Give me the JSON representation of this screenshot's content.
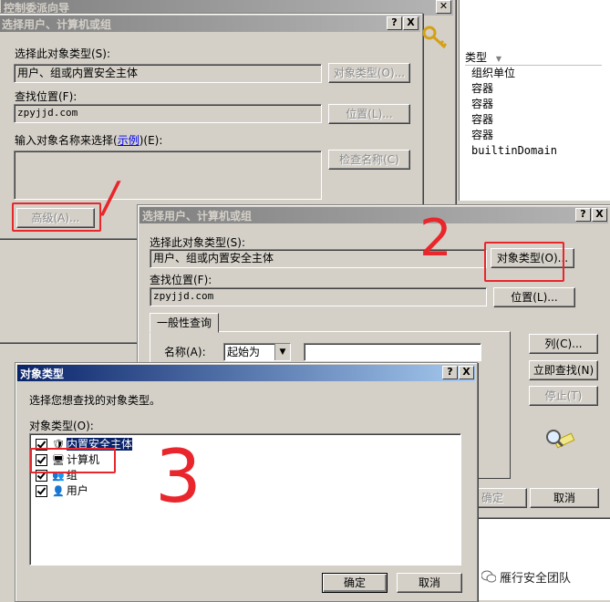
{
  "bg_wizard": {
    "title": "控制委派向导"
  },
  "right_panel": {
    "column_header": "类型",
    "items": [
      "组织单位",
      "容器",
      "容器",
      "容器",
      "容器",
      "builtinDomain"
    ]
  },
  "dialog1": {
    "title": "选择用户、计算机或组",
    "help": "?",
    "close": "X",
    "obj_type_label": "选择此对象类型(S):",
    "obj_type_value": "用户、组或内置安全主体",
    "obj_type_btn": "对象类型(O)...",
    "location_label": "查找位置(F):",
    "location_value": "zpyjjd.com",
    "location_btn": "位置(L)...",
    "enter_label_pre": "输入对象名称来选择(",
    "enter_label_link": "示例",
    "enter_label_post": ")(E):",
    "check_names_btn": "检查名称(C)",
    "advanced_btn": "高级(A)..."
  },
  "dialog2": {
    "title": "选择用户、计算机或组",
    "help": "?",
    "close": "X",
    "obj_type_label": "选择此对象类型(S):",
    "obj_type_value": "用户、组或内置安全主体",
    "obj_type_btn": "对象类型(O)...",
    "location_label": "查找位置(F):",
    "location_value": "zpyjjd.com",
    "location_btn": "位置(L)...",
    "tab": "一般性查询",
    "name_label": "名称(A):",
    "name_mode": "起始为",
    "columns_btn": "列(C)...",
    "find_now_btn": "立即查找(N)",
    "stop_btn": "停止(T)",
    "ok_btn": "确定",
    "cancel_btn": "取消"
  },
  "dialog3": {
    "title": "对象类型",
    "help": "?",
    "close": "X",
    "prompt": "选择您想查找的对象类型。",
    "list_label": "对象类型(O):",
    "items": [
      {
        "label": "内置安全主体",
        "checked": true
      },
      {
        "label": "计算机",
        "checked": true
      },
      {
        "label": "组",
        "checked": true
      },
      {
        "label": "用户",
        "checked": true
      }
    ],
    "ok_btn": "确定",
    "cancel_btn": "取消"
  },
  "annotations": {
    "step1": "/",
    "step2": "2",
    "step3": "3",
    "color": "#e8262c"
  },
  "watermark": {
    "text": "雁行安全团队"
  }
}
